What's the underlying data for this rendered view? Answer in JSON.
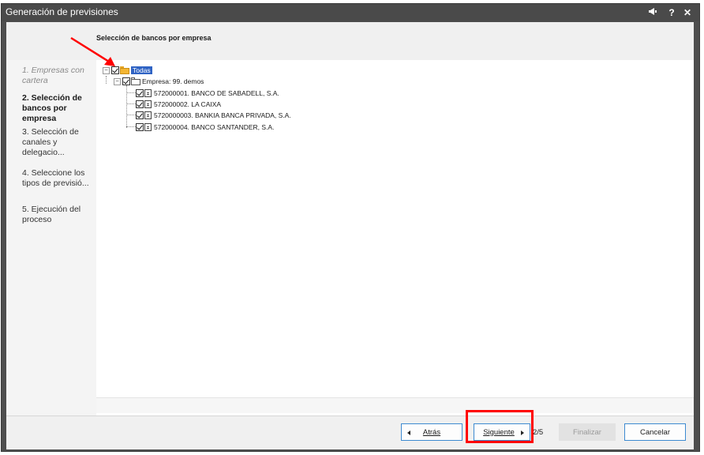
{
  "window": {
    "title": "Generación de previsiones",
    "controls": {
      "pin": "📢",
      "help": "?",
      "close": "✕"
    }
  },
  "header": {
    "step_title": "Selección de bancos por empresa"
  },
  "steps": [
    {
      "label": "1. Empresas con cartera",
      "state": "done"
    },
    {
      "label": "2. Selección de bancos por empresa",
      "state": "active"
    },
    {
      "label": "3. Selección de canales y delegacio...",
      "state": "pending"
    },
    {
      "label": "4. Seleccione los tipos de previsió...",
      "state": "pending"
    },
    {
      "label": "5. Ejecución del proceso",
      "state": "pending"
    }
  ],
  "tree": {
    "root": {
      "label": "Todas",
      "checked": true,
      "expanded": true,
      "icon": "folder-open-icon"
    },
    "empresa": {
      "label": "Empresa: 99. demos",
      "checked": true,
      "expanded": true,
      "icon": "folder-icon"
    },
    "banks": [
      {
        "label": "572000001. BANCO DE SABADELL, S.A.",
        "checked": true
      },
      {
        "label": "572000002. LA CAIXA",
        "checked": true
      },
      {
        "label": "5720000003. BANKIA BANCA PRIVADA, S.A.",
        "checked": true
      },
      {
        "label": "572000004. BANCO SANTANDER, S.A.",
        "checked": true
      }
    ]
  },
  "buttons": {
    "back": "Atrás",
    "next": "Siguiente",
    "page": "2/5",
    "finish": "Finalizar",
    "cancel": "Cancelar"
  },
  "colors": {
    "titlebar": "#4a4a4a",
    "selection": "#2f63c4",
    "button_border": "#3d8ad1",
    "annotation": "#ff0000"
  }
}
